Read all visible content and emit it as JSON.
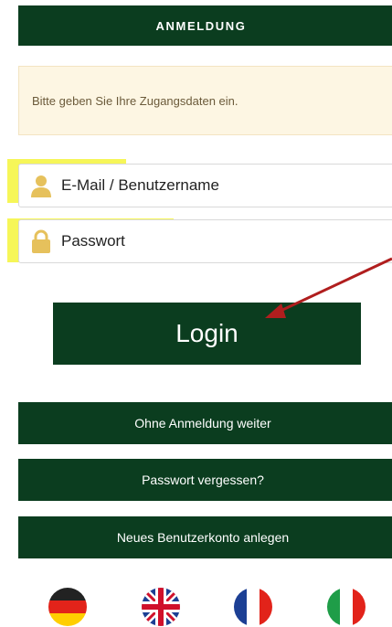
{
  "header": {
    "title": "ANMELDUNG"
  },
  "notice": {
    "text": "Bitte geben Sie Ihre Zugangsdaten ein."
  },
  "form": {
    "email_placeholder": "E-Mail / Benutzername",
    "password_placeholder": "Passwort",
    "login_label": "Login"
  },
  "actions": {
    "guest_label": "Ohne Anmeldung weiter",
    "forgot_label": "Passwort vergessen?",
    "register_label": "Neues Benutzerkonto anlegen"
  },
  "languages": [
    "german-flag-icon",
    "uk-flag-icon",
    "french-flag-icon",
    "italian-flag-icon"
  ],
  "colors": {
    "brand_green": "#0b3d1f",
    "highlight": "#f5f53b",
    "notice_bg": "#fdf6e3",
    "arrow": "#b01e1e"
  }
}
